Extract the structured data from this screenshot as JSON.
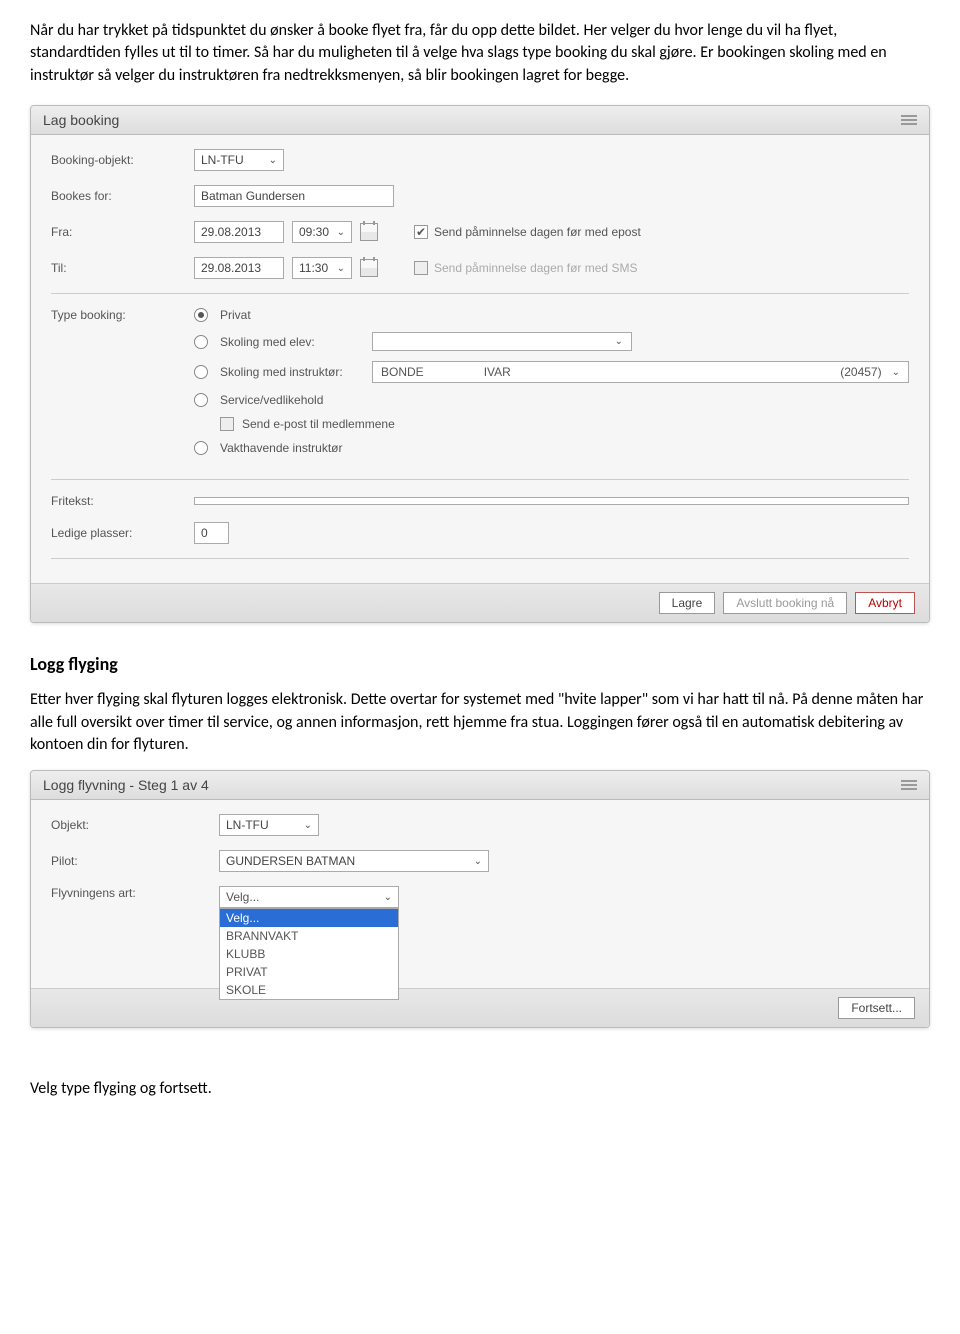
{
  "intro": "Når du har trykket på tidspunktet du ønsker å booke flyet fra, får du opp dette bildet. Her velger du hvor lenge du vil ha flyet, standardtiden fylles ut til to timer. Så har du muligheten til å velge hva slags type booking du skal gjøre. Er bookingen skoling med en instruktør så velger du instruktøren fra nedtrekksmenyen, så blir bookingen lagret for begge.",
  "booking": {
    "title": "Lag booking",
    "labels": {
      "object": "Booking-objekt:",
      "for": "Bookes for:",
      "from": "Fra:",
      "to": "Til:",
      "type": "Type booking:",
      "freetext": "Fritekst:",
      "seats": "Ledige plasser:"
    },
    "object_value": "LN-TFU",
    "booked_for": "Batman Gundersen",
    "from_date": "29.08.2013",
    "from_time": "09:30",
    "to_date": "29.08.2013",
    "to_time": "11:30",
    "reminder_email": "Send påminnelse dagen før med epost",
    "reminder_sms": "Send påminnelse dagen før med SMS",
    "types": {
      "privat": "Privat",
      "elev": "Skoling med elev:",
      "instruktor": "Skoling med instruktør:",
      "service": "Service/vedlikehold",
      "sendepost": "Send e-post til medlemmene",
      "vakthavende": "Vakthavende instruktør"
    },
    "instructor": {
      "last": "BONDE",
      "first": "IVAR",
      "id": "(20457)"
    },
    "freetext_value": "",
    "seats_value": "0",
    "buttons": {
      "save": "Lagre",
      "end": "Avslutt booking nå",
      "cancel": "Avbryt"
    }
  },
  "section_log_title": "Logg flyging",
  "log_intro": "Etter hver flyging skal flyturen logges elektronisk. Dette overtar for systemet med \"hvite lapper\" som vi har hatt til nå. På denne måten har alle full oversikt over timer til service, og annen informasjon, rett hjemme fra stua.  Loggingen fører også til en automatisk debitering av kontoen din for flyturen.",
  "log": {
    "title": "Logg flyvning - Steg 1 av 4",
    "labels": {
      "object": "Objekt:",
      "pilot": "Pilot:",
      "type": "Flyvningens art:"
    },
    "object_value": "LN-TFU",
    "pilot_value": "GUNDERSEN BATMAN",
    "type_selected": "Velg...",
    "type_options": [
      "Velg...",
      "BRANNVAKT",
      "KLUBB",
      "PRIVAT",
      "SKOLE"
    ],
    "continue": "Fortsett..."
  },
  "bottom": "Velg type flyging og fortsett."
}
